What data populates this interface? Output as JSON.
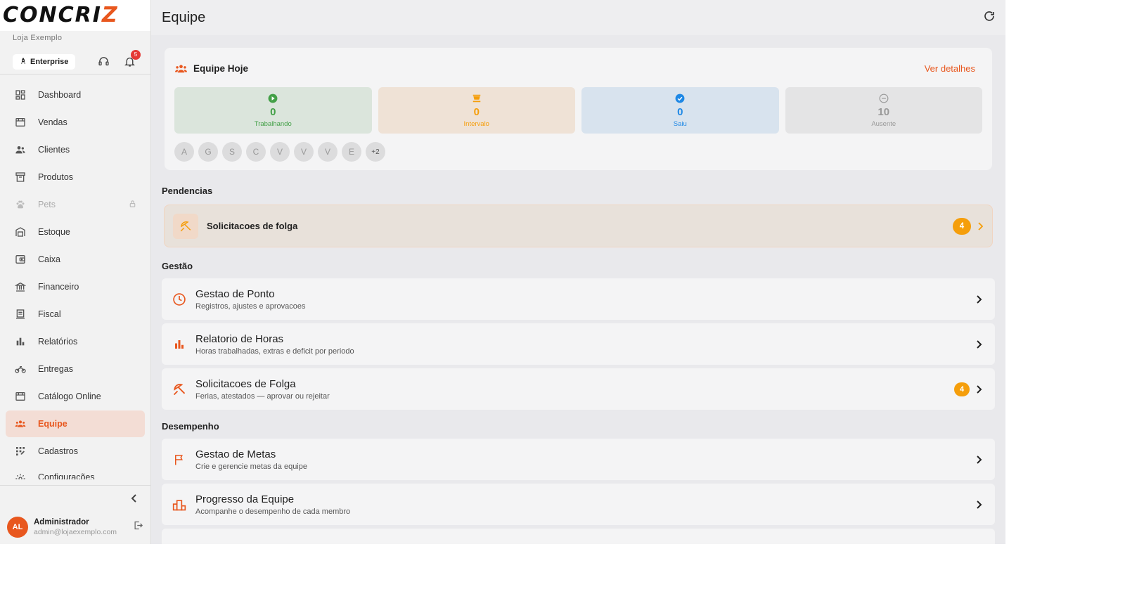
{
  "brand": {
    "logo_main": "CONCRI",
    "logo_accent": "Z",
    "store_name": "Loja Exemplo",
    "accent_color": "#e8571e"
  },
  "sidebar": {
    "plan_label": "Enterprise",
    "notifications_count": "5",
    "items": [
      {
        "label": "Dashboard",
        "icon": "dashboard-icon"
      },
      {
        "label": "Vendas",
        "icon": "store-icon"
      },
      {
        "label": "Clientes",
        "icon": "people-icon"
      },
      {
        "label": "Produtos",
        "icon": "box-icon"
      },
      {
        "label": "Pets",
        "icon": "paw-icon",
        "locked": true
      },
      {
        "label": "Estoque",
        "icon": "warehouse-icon"
      },
      {
        "label": "Caixa",
        "icon": "cash-icon"
      },
      {
        "label": "Financeiro",
        "icon": "bank-icon"
      },
      {
        "label": "Fiscal",
        "icon": "receipt-icon"
      },
      {
        "label": "Relatórios",
        "icon": "bar-chart-icon"
      },
      {
        "label": "Entregas",
        "icon": "motorcycle-icon"
      },
      {
        "label": "Catálogo Online",
        "icon": "storefront-icon"
      },
      {
        "label": "Equipe",
        "icon": "groups-icon",
        "active": true
      },
      {
        "label": "Cadastros",
        "icon": "grid-icon"
      },
      {
        "label": "Configurações",
        "icon": "gear-icon"
      }
    ],
    "user": {
      "initials": "AL",
      "name": "Administrador",
      "email": "admin@lojaexemplo.com"
    }
  },
  "header": {
    "title": "Equipe"
  },
  "team_today": {
    "title": "Equipe Hoje",
    "details_link": "Ver detalhes",
    "stats": [
      {
        "value": "0",
        "label": "Trabalhando",
        "color": "#43a047"
      },
      {
        "value": "0",
        "label": "Intervalo",
        "color": "#f59e0b"
      },
      {
        "value": "0",
        "label": "Saiu",
        "color": "#1e88e5"
      },
      {
        "value": "10",
        "label": "Ausente",
        "color": "#999999"
      }
    ],
    "members": [
      "A",
      "G",
      "S",
      "C",
      "V",
      "V",
      "V",
      "E"
    ],
    "more": "+2"
  },
  "pendencias": {
    "title": "Pendencias",
    "items": [
      {
        "label": "Solicitacoes de folga",
        "count": "4"
      }
    ]
  },
  "gestao": {
    "title": "Gestão",
    "items": [
      {
        "title": "Gestao de Ponto",
        "subtitle": "Registros, ajustes e aprovacoes",
        "icon": "clock-icon"
      },
      {
        "title": "Relatorio de Horas",
        "subtitle": "Horas trabalhadas, extras e deficit por periodo",
        "icon": "bar-chart-icon"
      },
      {
        "title": "Solicitacoes de Folga",
        "subtitle": "Ferias, atestados — aprovar ou rejeitar",
        "icon": "beach-icon",
        "count": "4"
      }
    ]
  },
  "desempenho": {
    "title": "Desempenho",
    "items": [
      {
        "title": "Gestao de Metas",
        "subtitle": "Crie e gerencie metas da equipe",
        "icon": "flag-icon"
      },
      {
        "title": "Progresso da Equipe",
        "subtitle": "Acompanhe o desempenho de cada membro",
        "icon": "leaderboard-icon"
      }
    ]
  }
}
